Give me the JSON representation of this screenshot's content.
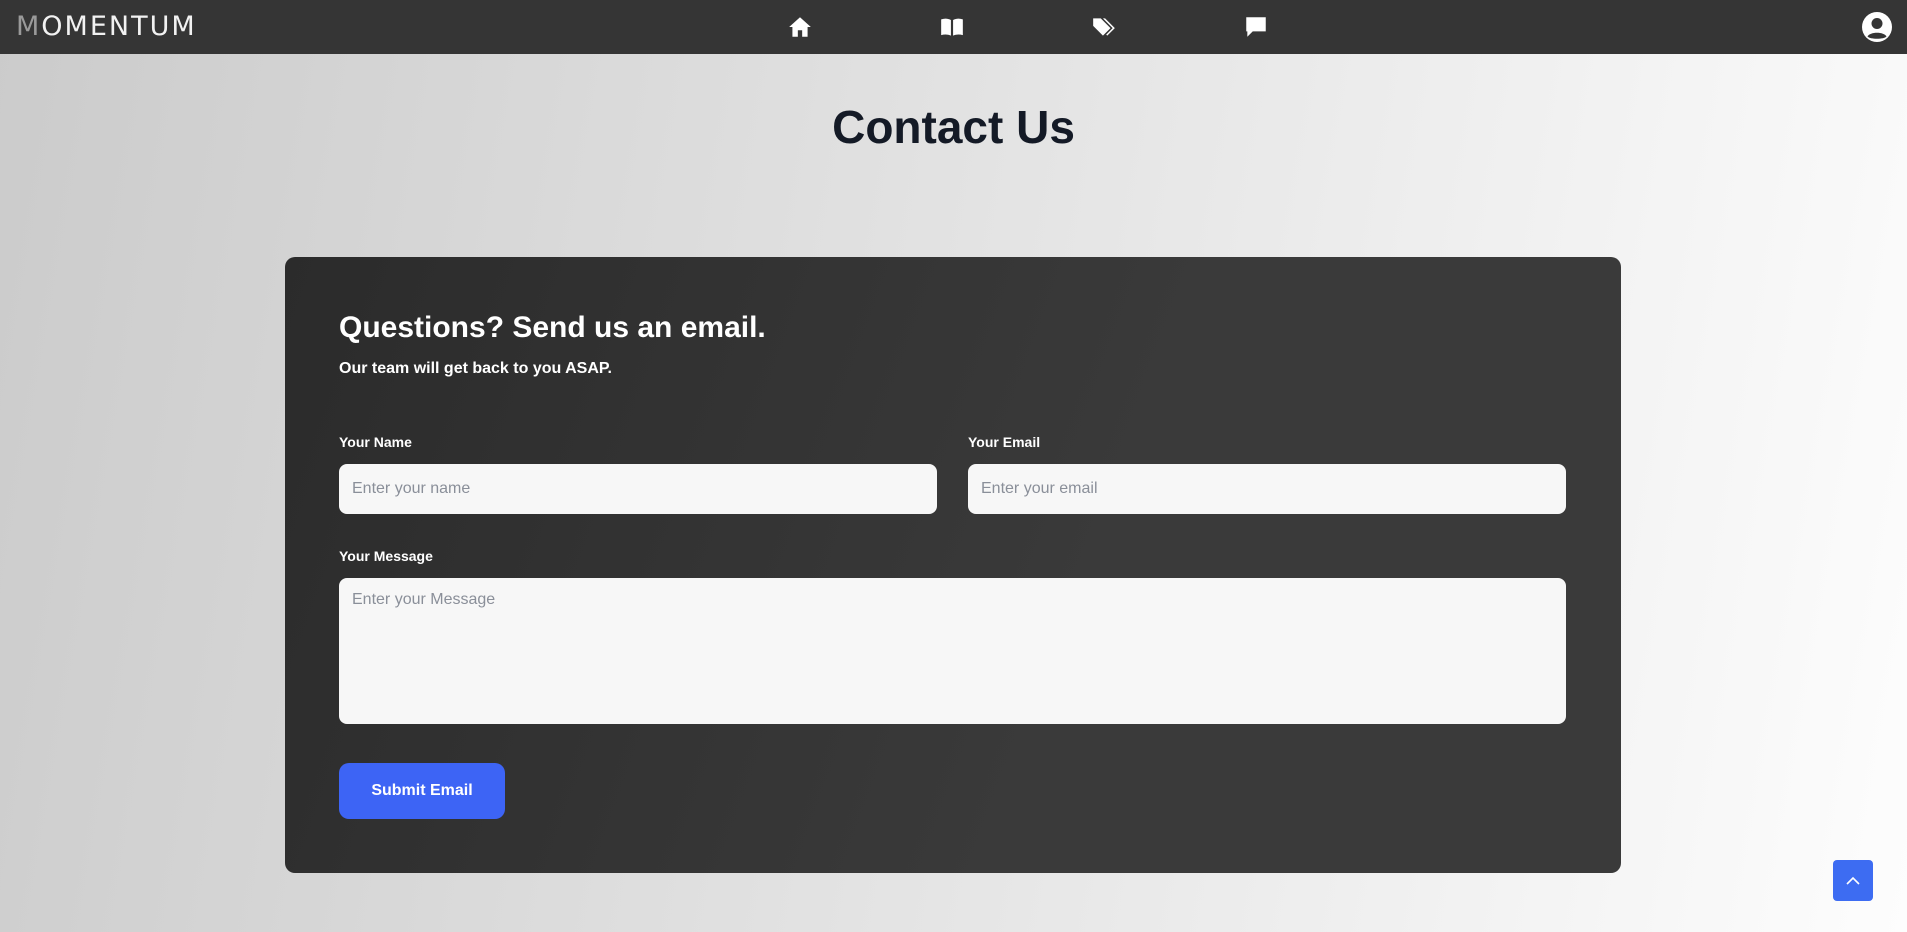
{
  "brand": {
    "logo_first": "M",
    "logo_rest": "OMENTUM"
  },
  "nav": {
    "icons": [
      "home-icon",
      "book-icon",
      "tags-icon",
      "comment-icon"
    ],
    "user_icon": "user-circle-icon"
  },
  "page": {
    "title": "Contact Us"
  },
  "form": {
    "title": "Questions? Send us an email.",
    "subtitle": "Our team will get back to you ASAP.",
    "name_label": "Your Name",
    "name_placeholder": "Enter your name",
    "email_label": "Your Email",
    "email_placeholder": "Enter your email",
    "message_label": "Your Message",
    "message_placeholder": "Enter your Message",
    "submit_label": "Submit Email"
  },
  "scroll_top": {
    "icon": "chevron-up-icon"
  },
  "colors": {
    "nav_bg": "#353535",
    "card_bg": "#2f2f2f",
    "accent": "#3d64f5",
    "title": "#141a26"
  }
}
